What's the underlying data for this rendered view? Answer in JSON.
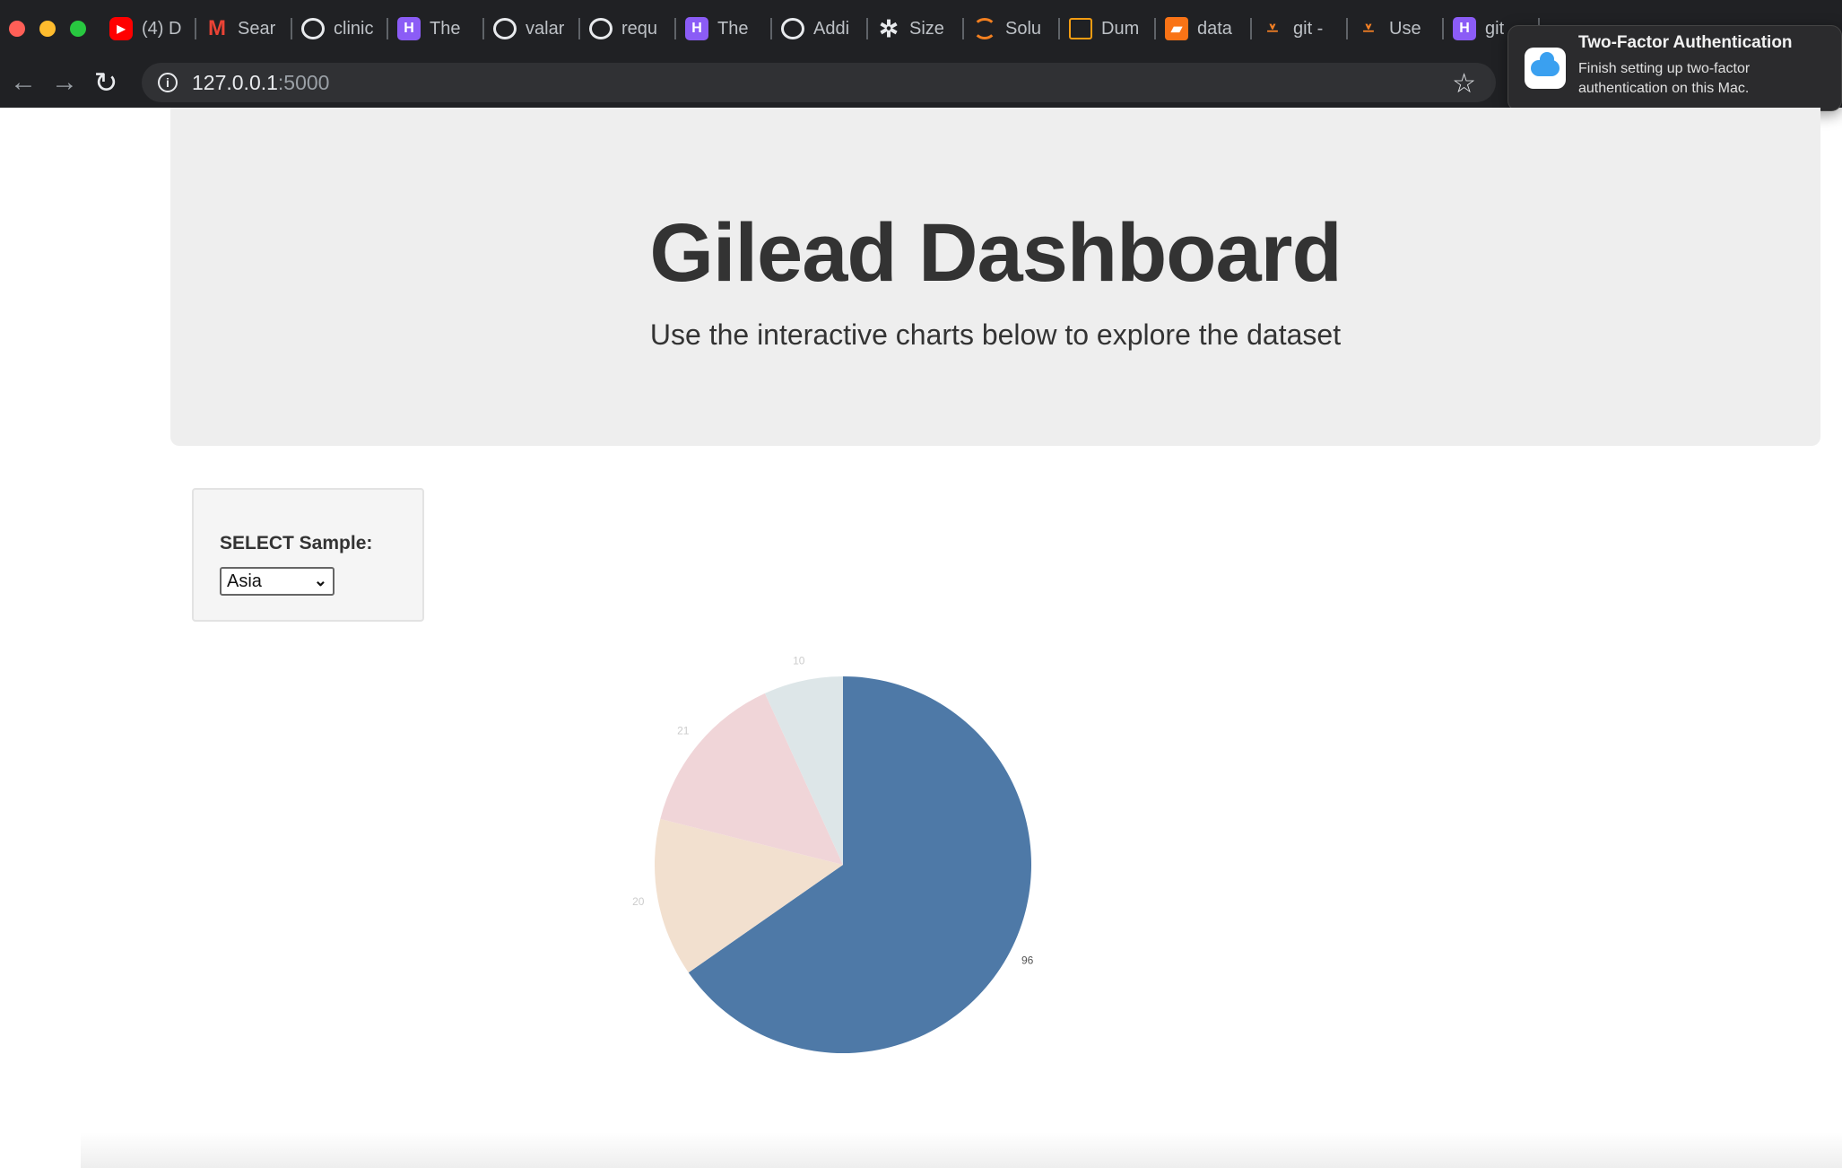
{
  "browser": {
    "tabs": [
      {
        "label": "(4) D",
        "icon": "youtube-icon"
      },
      {
        "label": "Sear",
        "icon": "gmail-icon"
      },
      {
        "label": "clinic",
        "icon": "github-icon"
      },
      {
        "label": "The",
        "icon": "hashnode-icon"
      },
      {
        "label": "valar",
        "icon": "github-icon"
      },
      {
        "label": "requ",
        "icon": "github-icon"
      },
      {
        "label": "The",
        "icon": "hashnode-icon"
      },
      {
        "label": "Addi",
        "icon": "github-icon"
      },
      {
        "label": "Size",
        "icon": "tableau-icon"
      },
      {
        "label": "Solu",
        "icon": "refresh-site-icon"
      },
      {
        "label": "Dum",
        "icon": "document-icon"
      },
      {
        "label": "data",
        "icon": "book-icon"
      },
      {
        "label": "git -",
        "icon": "stackoverflow-icon"
      },
      {
        "label": "Use",
        "icon": "stackoverflow-icon"
      },
      {
        "label": "git",
        "icon": "hashnode-icon"
      }
    ],
    "url_host": "127.0.0.1",
    "url_port": ":5000"
  },
  "notification": {
    "title": "Two-Factor Authentication",
    "body": "Finish setting up two-factor authentication on this Mac."
  },
  "header": {
    "title": "Gilead Dashboard",
    "subtitle": "Use the interactive charts below to explore the dataset"
  },
  "selector": {
    "label": "SELECT Sample:",
    "selected": "Asia"
  },
  "chart_data": {
    "type": "pie",
    "values": [
      96,
      20,
      21,
      10
    ],
    "labels": [
      "96",
      "20",
      "21",
      "10"
    ],
    "colors": [
      "#4e79a7",
      "#f2e0cf",
      "#f0d5d8",
      "#dde6e8"
    ],
    "label_colors": [
      "#555555",
      "#cccccc",
      "#cccccc",
      "#cccccc"
    ],
    "title": "",
    "legend": "none"
  }
}
